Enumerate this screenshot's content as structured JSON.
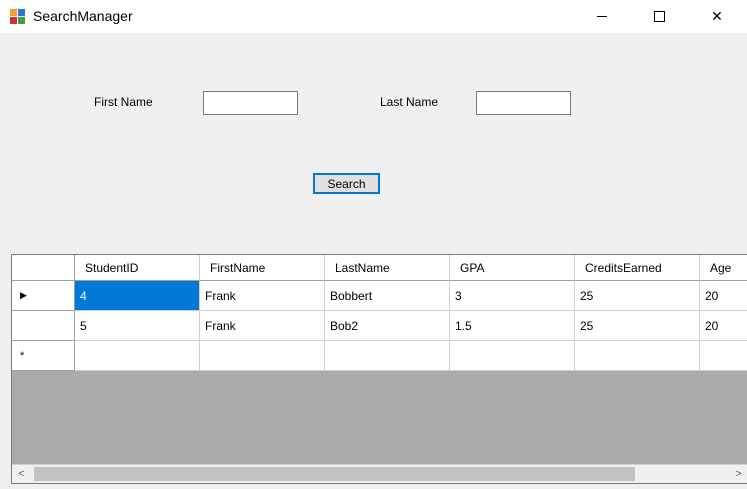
{
  "window": {
    "title": "SearchManager",
    "minimize_glyph": "",
    "close_glyph": "✕"
  },
  "form": {
    "first_name_label": "First Name",
    "first_name_value": "",
    "last_name_label": "Last Name",
    "last_name_value": "",
    "search_button": "Search"
  },
  "grid": {
    "columns": [
      "StudentID",
      "FirstName",
      "LastName",
      "GPA",
      "CreditsEarned",
      "Age"
    ],
    "rows": [
      [
        "4",
        "Frank",
        "Bobbert",
        "3",
        "25",
        "20"
      ],
      [
        "5",
        "Frank",
        "Bob2",
        "1.5",
        "25",
        "20"
      ]
    ],
    "current_row_glyph": "▶",
    "new_row_glyph": "*",
    "selected_cell": "row 1, StudentID"
  },
  "scrollbar": {
    "left_arrow": "<",
    "right_arrow": ">"
  },
  "colors": {
    "selection": "#0078d7",
    "grid_background": "#ababab",
    "form_background": "#f0f0f0"
  }
}
